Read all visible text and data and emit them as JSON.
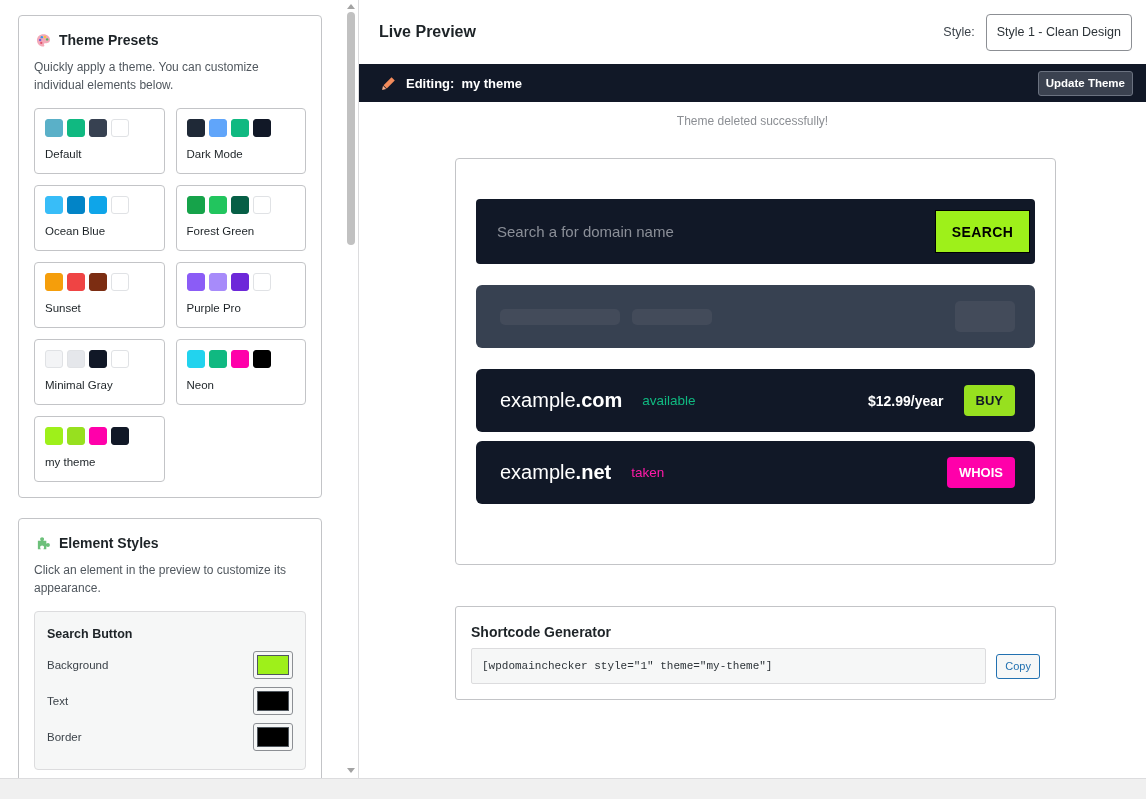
{
  "sidebar": {
    "theme_presets": {
      "title": "Theme Presets",
      "description": "Quickly apply a theme. You can customize individual elements below.",
      "presets": [
        {
          "name": "Default",
          "swatches": [
            {
              "color": "#5ab0c8"
            },
            {
              "color": "#10b981"
            },
            {
              "color": "#374151"
            },
            {
              "color": "#ffffff"
            }
          ]
        },
        {
          "name": "Dark Mode",
          "swatches": [
            {
              "color": "#1f2937"
            },
            {
              "color": "#60a5fa"
            },
            {
              "color": "#10b981"
            },
            {
              "color": "#111827"
            }
          ]
        },
        {
          "name": "Ocean Blue",
          "swatches": [
            {
              "color": "#38bdf8"
            },
            {
              "color": "#0284c7"
            },
            {
              "color": "#0ea5e9"
            },
            {
              "color": "#ffffff"
            }
          ]
        },
        {
          "name": "Forest Green",
          "swatches": [
            {
              "color": "#16a34a"
            },
            {
              "color": "#22c55e"
            },
            {
              "color": "#065f46"
            },
            {
              "color": "#ffffff"
            }
          ]
        },
        {
          "name": "Sunset",
          "swatches": [
            {
              "color": "#f59e0b"
            },
            {
              "color": "#ef4444"
            },
            {
              "color": "#7c2d12"
            },
            {
              "color": "#ffffff"
            }
          ]
        },
        {
          "name": "Purple Pro",
          "swatches": [
            {
              "color": "#8b5cf6"
            },
            {
              "color": "#a78bfa"
            },
            {
              "color": "#6d28d9"
            },
            {
              "color": "#ffffff"
            }
          ]
        },
        {
          "name": "Minimal Gray",
          "swatches": [
            {
              "color": "#f3f4f6"
            },
            {
              "color": "#e5e7eb"
            },
            {
              "color": "#111827"
            },
            {
              "color": "#ffffff"
            }
          ]
        },
        {
          "name": "Neon",
          "swatches": [
            {
              "color": "#22d3ee"
            },
            {
              "color": "#10b981"
            },
            {
              "color": "#ff00aa"
            },
            {
              "color": "#000000"
            }
          ]
        },
        {
          "name": "my theme",
          "swatches": [
            {
              "color": "#9ef01a"
            },
            {
              "color": "#97e01f"
            },
            {
              "color": "#ff00aa"
            },
            {
              "color": "#111827"
            }
          ]
        }
      ]
    },
    "element_styles": {
      "title": "Element Styles",
      "description": "Click an element in the preview to customize its appearance.",
      "element": {
        "title": "Search Button",
        "properties": [
          {
            "label": "Background",
            "color": "#9ef01a"
          },
          {
            "label": "Text",
            "color": "#000000"
          },
          {
            "label": "Border",
            "color": "#000000"
          }
        ]
      }
    }
  },
  "preview": {
    "title": "Live Preview",
    "style_label": "Style:",
    "style_select": {
      "value": "Style 1 - Clean Design"
    },
    "editing_bar": {
      "label": "Editing:",
      "theme_name": "my theme",
      "button": "Update Theme"
    },
    "notice": "Theme deleted successfully!",
    "search": {
      "placeholder": "Search a for domain name",
      "button": "SEARCH"
    },
    "results": [
      {
        "kind": "available",
        "domain": "example**.com**",
        "status": "available",
        "price": "$12.99/year",
        "action": "BUY"
      },
      {
        "kind": "taken",
        "domain": "example**.net**",
        "status": "taken",
        "action": "WHOIS"
      }
    ]
  },
  "shortcode": {
    "title": "Shortcode Generator",
    "code": "[wpdomainchecker style=\"1\" theme=\"my-theme\"]",
    "button": "Copy"
  }
}
